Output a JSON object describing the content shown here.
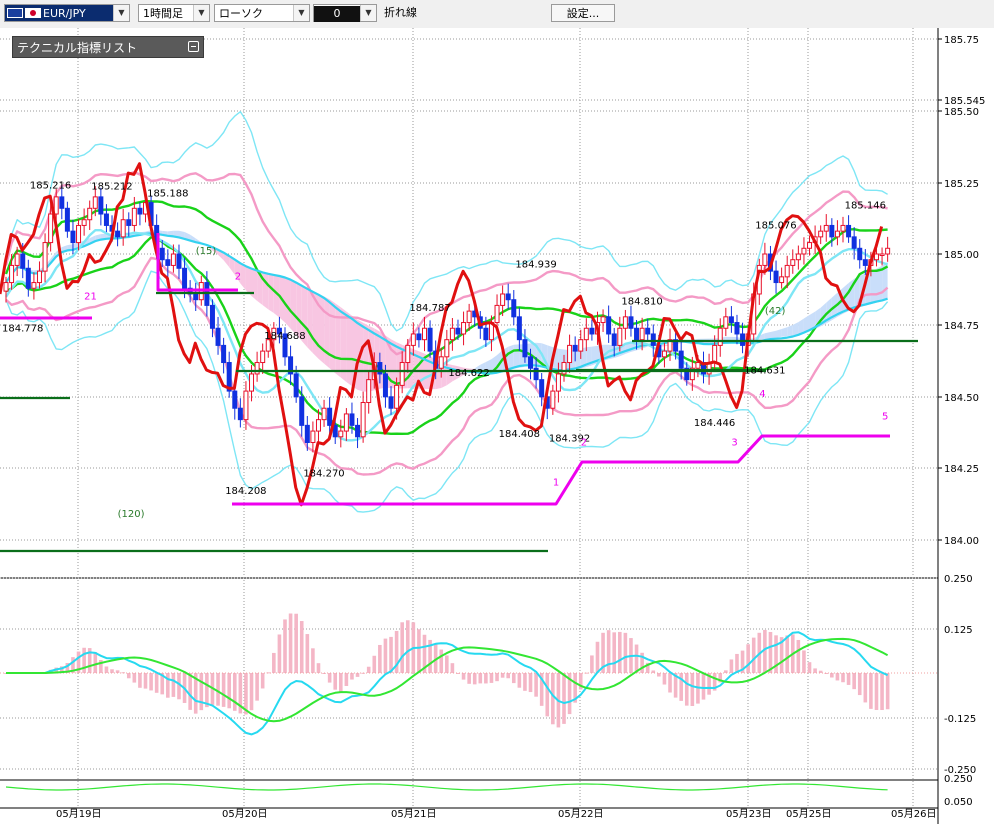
{
  "toolbar": {
    "symbol": "EUR/JPY",
    "timeframe": "1時間足",
    "chart_type": "ローソク",
    "value": "0",
    "line_type": "折れ線",
    "settings": "設定..."
  },
  "indicator_panel": {
    "label": "テクニカル指標リスト"
  },
  "colors": {
    "bull": "#e8102a",
    "bear": "#1030e0",
    "bb_outer": "#7ee6f5",
    "bb_inner": "#f49ac6",
    "bb_mid": "#19d219",
    "ma": "#34d2f0",
    "cloud_up": "#c9defa",
    "cloud_dn": "#f8c6e2",
    "red_line": "#e01010",
    "magenta": "#ee00ee",
    "dkgreen": "#0a6e1a",
    "macd": "#26d9f0",
    "signal": "#33e633",
    "hist": "#f4b6c6"
  },
  "chart_data": {
    "type": "candlestick",
    "ylim": [
      184.0,
      185.75
    ],
    "y_ticks": [
      "185.75",
      "185.545",
      "185.50",
      "185.25",
      "185.00",
      "184.75",
      "184.50",
      "184.25",
      "184.00"
    ],
    "x_ticks": [
      "05月19日",
      "05月20日",
      "05月21日",
      "05月22日",
      "05月23日",
      "05月25日",
      "05月26日"
    ],
    "price_labels": [
      {
        "x": 5,
        "y": 185.216,
        "text": "185.216"
      },
      {
        "x": 16,
        "y": 185.212,
        "text": "185.212"
      },
      {
        "x": 26,
        "y": 185.188,
        "text": "185.188"
      },
      {
        "x": 0,
        "y": 184.778,
        "text": "184.778"
      },
      {
        "x": 40,
        "y": 184.208,
        "text": "184.208"
      },
      {
        "x": 54,
        "y": 184.27,
        "text": "184.270"
      },
      {
        "x": 47,
        "y": 184.688,
        "text": "184.688"
      },
      {
        "x": 73,
        "y": 184.787,
        "text": "184.787"
      },
      {
        "x": 80,
        "y": 184.622,
        "text": "184.622"
      },
      {
        "x": 92,
        "y": 184.939,
        "text": "184.939"
      },
      {
        "x": 89,
        "y": 184.408,
        "text": "184.408"
      },
      {
        "x": 98,
        "y": 184.392,
        "text": "184.392"
      },
      {
        "x": 111,
        "y": 184.81,
        "text": "184.810"
      },
      {
        "x": 124,
        "y": 184.446,
        "text": "184.446"
      },
      {
        "x": 133,
        "y": 184.631,
        "text": "184.631"
      },
      {
        "x": 135,
        "y": 185.076,
        "text": "185.076"
      },
      {
        "x": 151,
        "y": 185.146,
        "text": "185.146"
      }
    ],
    "annotations": [
      {
        "text": "(15)",
        "x": 34,
        "y": 185.0
      },
      {
        "text": "2",
        "x": 41,
        "y": 184.91
      },
      {
        "text": "21",
        "x": 14,
        "y": 184.84
      },
      {
        "text": "(120)",
        "x": 20,
        "y": 184.08
      },
      {
        "text": "1",
        "x": 98,
        "y": 184.19
      },
      {
        "text": "2",
        "x": 103,
        "y": 184.33
      },
      {
        "text": "3",
        "x": 130,
        "y": 184.33
      },
      {
        "text": "4",
        "x": 135,
        "y": 184.5
      },
      {
        "text": "5",
        "x": 157,
        "y": 184.42
      },
      {
        "text": "(42)",
        "x": 136,
        "y": 184.79
      }
    ],
    "series": {
      "close": [
        184.9,
        184.96,
        185.0,
        184.95,
        184.88,
        184.9,
        184.94,
        185.04,
        185.14,
        185.2,
        185.16,
        185.08,
        185.04,
        185.1,
        185.12,
        185.16,
        185.2,
        185.14,
        185.1,
        185.08,
        185.06,
        185.12,
        185.1,
        185.16,
        185.14,
        185.18,
        185.1,
        185.02,
        184.98,
        184.96,
        185.0,
        184.95,
        184.88,
        184.86,
        184.84,
        184.9,
        184.82,
        184.74,
        184.68,
        184.62,
        184.52,
        184.46,
        184.42,
        184.52,
        184.58,
        184.62,
        184.66,
        184.7,
        184.74,
        184.72,
        184.64,
        184.58,
        184.5,
        184.4,
        184.34,
        184.38,
        184.42,
        184.46,
        184.4,
        184.36,
        184.38,
        184.44,
        184.4,
        184.36,
        184.48,
        184.56,
        184.62,
        184.58,
        184.5,
        184.46,
        184.54,
        184.62,
        184.68,
        184.72,
        184.7,
        184.74,
        184.66,
        184.6,
        184.64,
        184.7,
        184.74,
        184.72,
        184.76,
        184.8,
        184.78,
        184.74,
        184.7,
        184.76,
        184.82,
        184.86,
        184.84,
        184.78,
        184.7,
        184.64,
        184.6,
        184.56,
        184.5,
        184.46,
        184.52,
        184.58,
        184.62,
        184.68,
        184.66,
        184.7,
        184.74,
        184.72,
        184.76,
        184.78,
        184.72,
        184.68,
        184.74,
        184.78,
        184.74,
        184.7,
        184.74,
        184.72,
        184.68,
        184.64,
        184.66,
        184.7,
        184.66,
        184.6,
        184.56,
        184.6,
        184.62,
        184.58,
        184.62,
        184.68,
        184.74,
        184.78,
        184.76,
        184.72,
        184.68,
        184.72,
        184.86,
        184.96,
        185.0,
        184.94,
        184.9,
        184.92,
        184.96,
        184.98,
        185.0,
        185.02,
        185.04,
        185.06,
        185.08,
        185.1,
        185.06,
        185.08,
        185.1,
        185.06,
        185.02,
        184.98,
        184.96,
        184.98,
        185.0,
        185.0,
        185.02
      ]
    },
    "macd": {
      "ylim": [
        -0.25,
        0.25
      ],
      "y_ticks": [
        "0.250",
        "0.125",
        "-0.125",
        "-0.250"
      ]
    },
    "sub": {
      "y_ticks": [
        "0.250",
        "0.050"
      ]
    }
  }
}
